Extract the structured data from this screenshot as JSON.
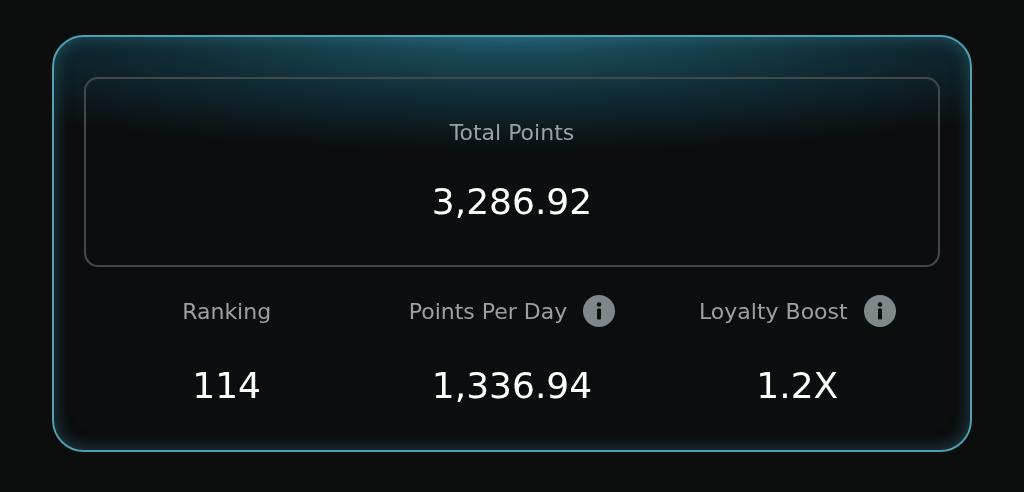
{
  "total": {
    "label": "Total Points",
    "value": "3,286.92"
  },
  "stats": [
    {
      "label": "Ranking",
      "value": "114",
      "info": false
    },
    {
      "label": "Points Per Day",
      "value": "1,336.94",
      "info": true
    },
    {
      "label": "Loyalty Boost",
      "value": "1.2X",
      "info": true
    }
  ]
}
